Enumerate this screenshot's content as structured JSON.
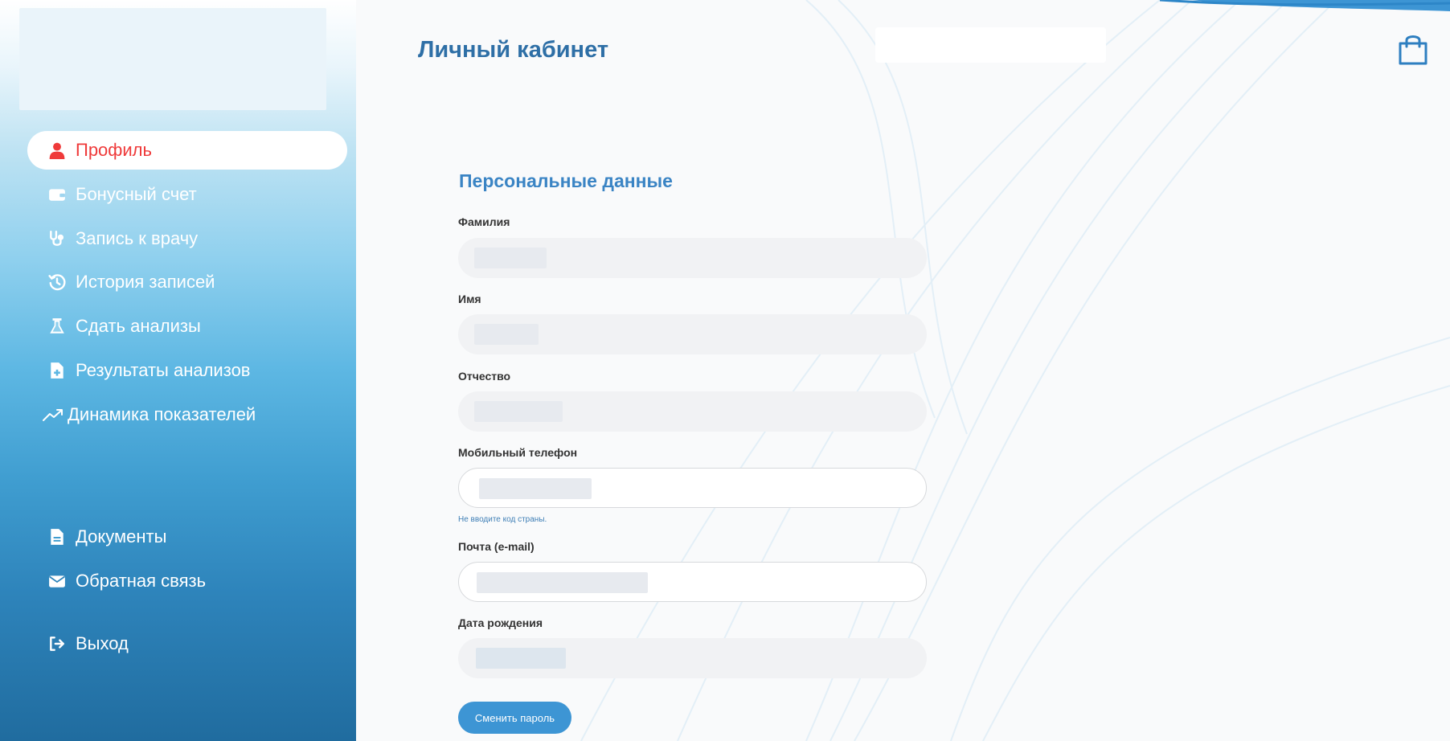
{
  "sidebar": {
    "items": [
      {
        "label": "Профиль",
        "icon": "user-icon"
      },
      {
        "label": "Бонусный счет",
        "icon": "wallet-icon"
      },
      {
        "label": "Запись к врачу",
        "icon": "stethoscope-icon"
      },
      {
        "label": "История записей",
        "icon": "history-icon"
      },
      {
        "label": "Сдать анализы",
        "icon": "flask-icon"
      },
      {
        "label": "Результаты анализов",
        "icon": "file-medical-icon"
      },
      {
        "label": "Динамика показателей",
        "icon": "trend-icon"
      }
    ],
    "bottom_items": [
      {
        "label": "Документы",
        "icon": "document-icon"
      },
      {
        "label": "Обратная связь",
        "icon": "envelope-icon"
      },
      {
        "label": "Выход",
        "icon": "logout-icon"
      }
    ]
  },
  "header": {
    "title": "Личный кабинет"
  },
  "form": {
    "section_title": "Персональные данные",
    "fields": [
      {
        "label": "Фамилия"
      },
      {
        "label": "Имя"
      },
      {
        "label": "Отчество"
      },
      {
        "label": "Мобильный телефон"
      },
      {
        "label": "Почта (e-mail)"
      },
      {
        "label": "Дата рождения"
      }
    ],
    "phone_hint": "Не вводите код страны.",
    "change_password_label": "Сменить пароль"
  },
  "colors": {
    "accent": "#3d95d4",
    "active_nav": "#ef3a3a",
    "title": "#2e6fa6"
  }
}
